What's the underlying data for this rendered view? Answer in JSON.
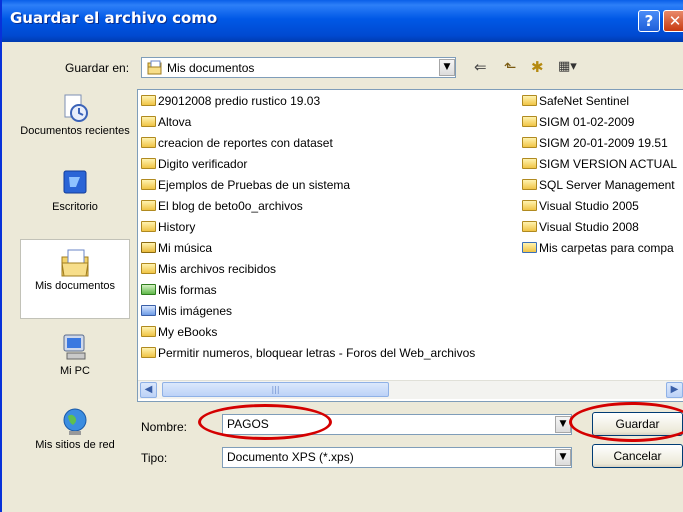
{
  "window": {
    "title": "Guardar el archivo como",
    "help_glyph": "?",
    "close_glyph": "✕"
  },
  "toolbar": {
    "save_in_label": "Guardar en:",
    "save_in_value": "Mis documentos",
    "back_glyph": "⇐",
    "up_glyph": "⬑",
    "new_folder_glyph": "✱",
    "views_glyph": "▦▾",
    "dropdown_glyph": "▼"
  },
  "places": [
    {
      "label": "Documentos recientes",
      "icon": "recent-documents-icon"
    },
    {
      "label": "Escritorio",
      "icon": "desktop-icon"
    },
    {
      "label": "Mis documentos",
      "icon": "my-documents-icon"
    },
    {
      "label": "Mi PC",
      "icon": "my-computer-icon"
    },
    {
      "label": "Mis sitios de red",
      "icon": "network-places-icon"
    }
  ],
  "files": {
    "col1": [
      {
        "name": "29012008 predio rustico 19.03",
        "icon": "folder-icon"
      },
      {
        "name": "Altova",
        "icon": "folder-icon"
      },
      {
        "name": "creacion de reportes con dataset",
        "icon": "folder-icon"
      },
      {
        "name": "Digito verificador",
        "icon": "folder-icon"
      },
      {
        "name": "Ejemplos de Pruebas de un sistema",
        "icon": "folder-icon"
      },
      {
        "name": "El blog de beto0o_archivos",
        "icon": "folder-icon"
      },
      {
        "name": "History",
        "icon": "folder-icon"
      },
      {
        "name": "Mi música",
        "icon": "music-folder-icon"
      },
      {
        "name": "Mis archivos recibidos",
        "icon": "folder-icon"
      },
      {
        "name": "Mis formas",
        "icon": "forms-folder-icon"
      },
      {
        "name": "Mis imágenes",
        "icon": "pictures-folder-icon"
      },
      {
        "name": "My eBooks",
        "icon": "folder-icon"
      },
      {
        "name": "Permitir numeros, bloquear letras - Foros del Web_archivos",
        "icon": "folder-icon"
      }
    ],
    "col2": [
      {
        "name": "SafeNet Sentinel",
        "icon": "folder-icon"
      },
      {
        "name": "SIGM 01-02-2009",
        "icon": "folder-icon"
      },
      {
        "name": "SIGM 20-01-2009 19.51",
        "icon": "folder-icon"
      },
      {
        "name": "SIGM VERSION ACTUAL",
        "icon": "folder-icon"
      },
      {
        "name": "SQL Server Management",
        "icon": "folder-icon"
      },
      {
        "name": "Visual Studio 2005",
        "icon": "folder-icon"
      },
      {
        "name": "Visual Studio 2008",
        "icon": "folder-icon"
      },
      {
        "name": "Mis carpetas para compa",
        "icon": "shared-folder-icon"
      }
    ]
  },
  "scrollbar": {
    "left_glyph": "◀",
    "right_glyph": "▶",
    "grip": "|||"
  },
  "form": {
    "name_label": "Nombre:",
    "name_value": "PAGOS",
    "type_label": "Tipo:",
    "type_value": "Documento XPS (*.xps)",
    "save_button": "Guardar",
    "cancel_button": "Cancelar"
  },
  "colors": {
    "annotation": "#d40000",
    "title_bar": "#0058e6"
  }
}
